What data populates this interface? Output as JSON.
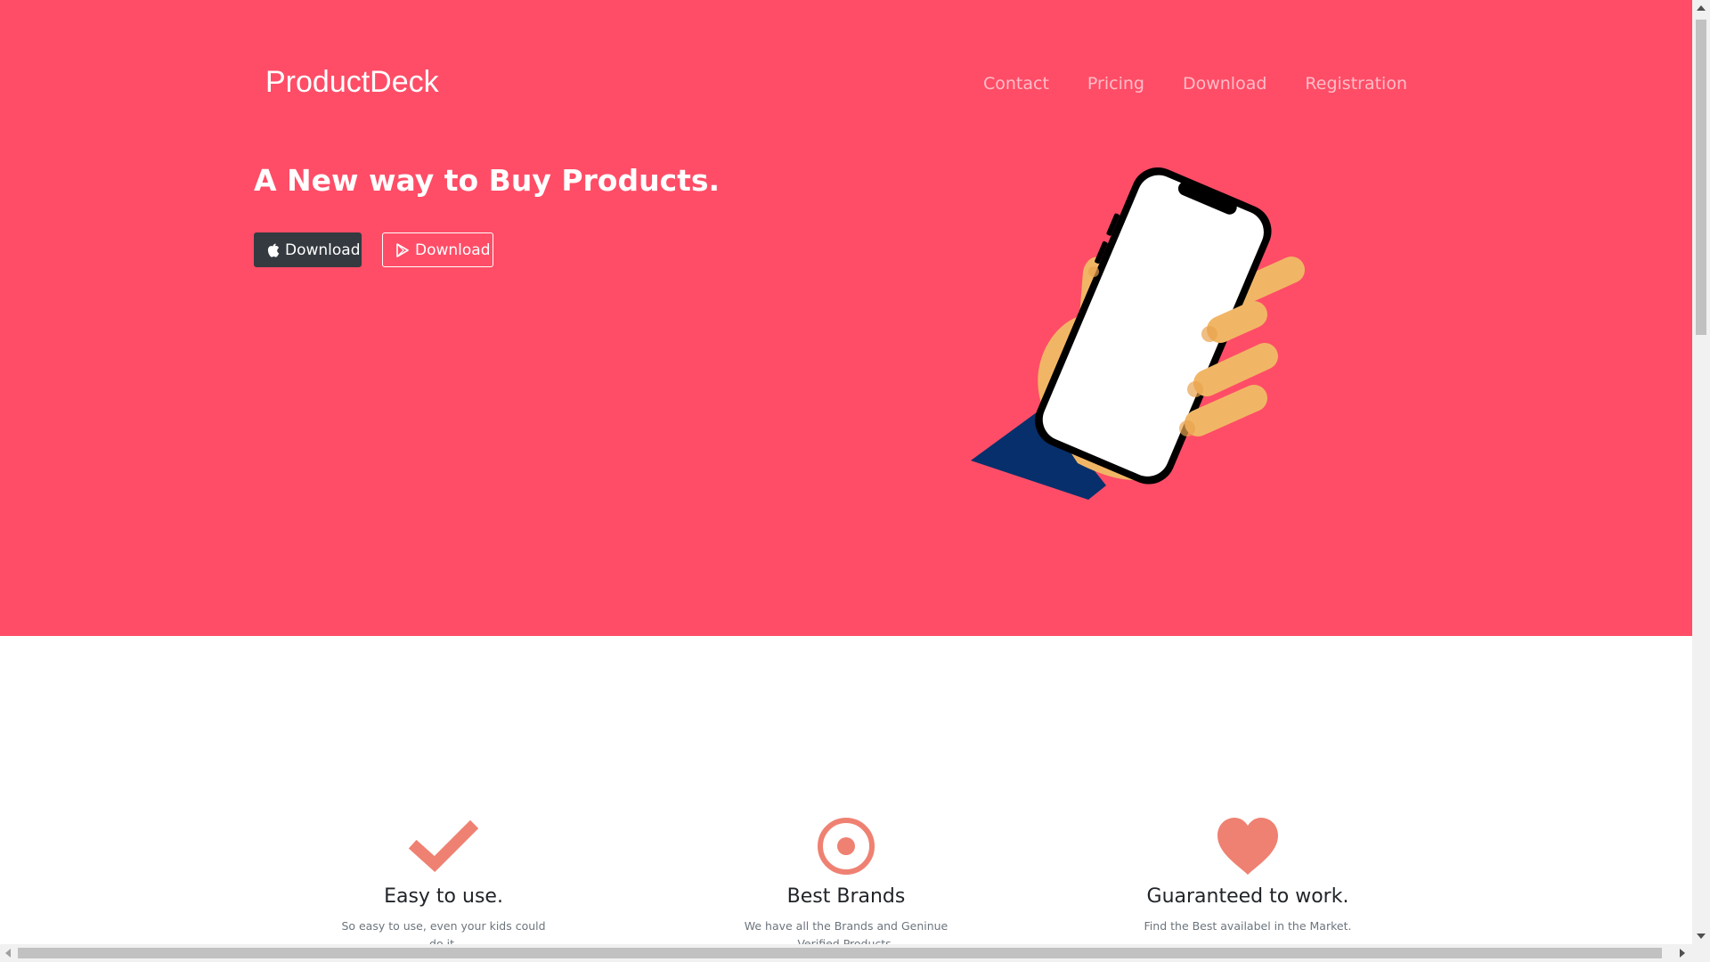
{
  "header": {
    "brand": "ProductDeck",
    "nav": [
      {
        "label": "Contact"
      },
      {
        "label": "Pricing"
      },
      {
        "label": "Download"
      },
      {
        "label": "Registration"
      }
    ]
  },
  "hero": {
    "headline": "A New way to Buy Products.",
    "buttons": {
      "apple": {
        "label": "Download",
        "icon": "apple-icon"
      },
      "google_play": {
        "label": "Download",
        "icon": "play-icon"
      }
    },
    "illustration": "hand-holding-phone"
  },
  "features": [
    {
      "icon": "check-icon",
      "title": "Easy to use.",
      "text": "So easy to use, even your kids could do it."
    },
    {
      "icon": "bullseye-icon",
      "title": "Best Brands",
      "text": "We have all the Brands and Geninue Verified Products."
    },
    {
      "icon": "heart-icon",
      "title": "Guaranteed to work.",
      "text": "Find the Best availabel in the Market."
    }
  ],
  "colors": {
    "hero_bg": "#ff4d67",
    "accent": "#ef8172",
    "dark_button": "#343a40",
    "sleeve": "#072f6b",
    "skin": "#f1b665"
  }
}
